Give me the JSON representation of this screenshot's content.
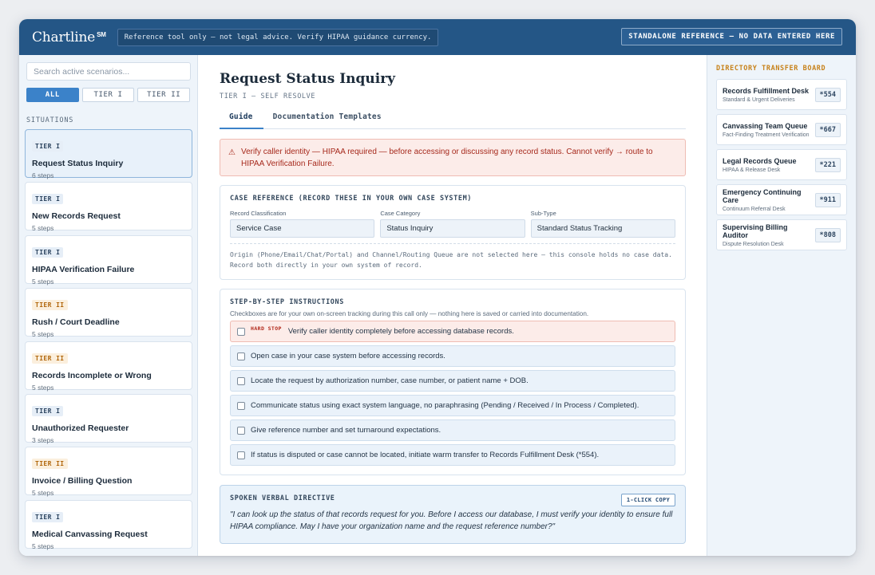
{
  "header": {
    "brand": "Chartline",
    "brand_mark": "SM",
    "banner": "Reference tool only — not legal advice. Verify HIPAA guidance currency.",
    "standalone": "STANDALONE REFERENCE — NO DATA ENTERED HERE"
  },
  "sidebar": {
    "search_placeholder": "Search active scenarios...",
    "filters": [
      "ALL",
      "TIER I",
      "TIER II"
    ],
    "section_label": "SITUATIONS",
    "scenarios": [
      {
        "tier": "TIER I",
        "title": "Request Status Inquiry",
        "steps": "6 steps"
      },
      {
        "tier": "TIER I",
        "title": "New Records Request",
        "steps": "5 steps"
      },
      {
        "tier": "TIER I",
        "title": "HIPAA Verification Failure",
        "steps": "5 steps"
      },
      {
        "tier": "TIER II",
        "title": "Rush / Court Deadline",
        "steps": "5 steps"
      },
      {
        "tier": "TIER II",
        "title": "Records Incomplete or Wrong",
        "steps": "5 steps"
      },
      {
        "tier": "TIER I",
        "title": "Unauthorized Requester",
        "steps": "3 steps"
      },
      {
        "tier": "TIER II",
        "title": "Invoice / Billing Question",
        "steps": "5 steps"
      },
      {
        "tier": "TIER I",
        "title": "Medical Canvassing Request",
        "steps": "5 steps"
      }
    ]
  },
  "main": {
    "title": "Request Status Inquiry",
    "subtitle": "TIER I — SELF RESOLVE",
    "tabs": [
      "Guide",
      "Documentation Templates"
    ],
    "alert": "Verify caller identity — HIPAA required — before accessing or discussing any record status. Cannot verify → route to HIPAA Verification Failure.",
    "case_ref": {
      "heading": "CASE REFERENCE (RECORD THESE IN YOUR OWN CASE SYSTEM)",
      "fields": [
        {
          "label": "Record Classification",
          "value": "Service Case"
        },
        {
          "label": "Case Category",
          "value": "Status Inquiry"
        },
        {
          "label": "Sub-Type",
          "value": "Standard Status Tracking"
        }
      ],
      "origin_note": "Origin (Phone/Email/Chat/Portal) and Channel/Routing Queue are not selected here — this console holds no case data. Record both directly in your own system of record."
    },
    "instructions": {
      "heading": "STEP-BY-STEP INSTRUCTIONS",
      "subheading": "Checkboxes are for your own on-screen tracking during this call only — nothing here is saved or carried into documentation.",
      "hard_stop_label": "HARD STOP",
      "steps": [
        "Verify caller identity completely before accessing database records.",
        "Open case in your case system before accessing records.",
        "Locate the request by authorization number, case number, or patient name + DOB.",
        "Communicate status using exact system language, no paraphrasing (Pending / Received / In Process / Completed).",
        "Give reference number and set turnaround expectations.",
        "If status is disputed or case cannot be located, initiate warm transfer to Records Fulfillment Desk (*554)."
      ]
    },
    "directive": {
      "heading": "SPOKEN VERBAL DIRECTIVE",
      "copy_label": "1-CLICK COPY",
      "text": "\"I can look up the status of that records request for you. Before I access our database, I must verify your identity to ensure full HIPAA compliance. May I have your organization name and the request reference number?\""
    }
  },
  "directory": {
    "heading": "DIRECTORY TRANSFER BOARD",
    "desks": [
      {
        "name": "Records Fulfillment Desk",
        "sub": "Standard & Urgent Deliveries",
        "ext": "*554"
      },
      {
        "name": "Canvassing Team Queue",
        "sub": "Fact-Finding Treatment Verification",
        "ext": "*667"
      },
      {
        "name": "Legal Records Queue",
        "sub": "HIPAA & Release Desk",
        "ext": "*221"
      },
      {
        "name": "Emergency Continuing Care",
        "sub": "Continuum Referral Desk",
        "ext": "*911"
      },
      {
        "name": "Supervising Billing Auditor",
        "sub": "Dispute Resolution Desk",
        "ext": "*808"
      }
    ]
  },
  "colors": {
    "topbar": "#245686",
    "accent": "#3b82c9",
    "tier2": "#b2680e",
    "alert": "#a6291c",
    "directory_heading": "#c7821b"
  }
}
